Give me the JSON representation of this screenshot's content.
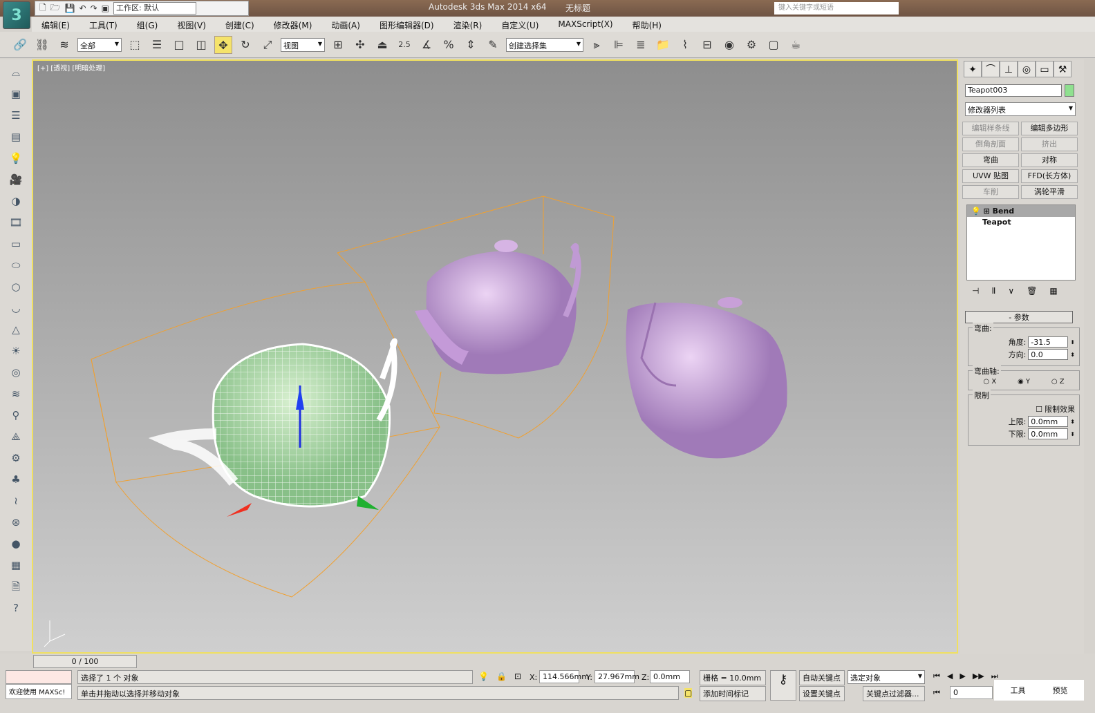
{
  "app": {
    "title": "Autodesk 3ds Max  2014 x64",
    "document": "无标题",
    "workspace": "工作区: 默认",
    "search_placeholder": "键入关键字或短语"
  },
  "menu": [
    "编辑(E)",
    "工具(T)",
    "组(G)",
    "视图(V)",
    "创建(C)",
    "修改器(M)",
    "动画(A)",
    "图形编辑器(D)",
    "渲染(R)",
    "自定义(U)",
    "MAXScript(X)",
    "帮助(H)"
  ],
  "toolbar": {
    "filter": "全部",
    "ref_coord": "视图",
    "snap_angle": "2.5",
    "selection_set": "创建选择集"
  },
  "viewport": {
    "label": "[+] [透视] [明暗处理]",
    "colors": {
      "border": "#f0e060",
      "bbox": "#f0a030",
      "teapot": "#c9a0d8",
      "selected": "#a8d8a0"
    }
  },
  "right_panel": {
    "object_name": "Teapot003",
    "modifier_list": "修改器列表",
    "modifier_buttons": [
      {
        "label": "编辑样条线",
        "enabled": false
      },
      {
        "label": "编辑多边形",
        "enabled": true
      },
      {
        "label": "倒角剖面",
        "enabled": false
      },
      {
        "label": "挤出",
        "enabled": false
      },
      {
        "label": "弯曲",
        "enabled": true
      },
      {
        "label": "对称",
        "enabled": true
      },
      {
        "label": "UVW 贴图",
        "enabled": true
      },
      {
        "label": "FFD(长方体)",
        "enabled": true
      },
      {
        "label": "车削",
        "enabled": false
      },
      {
        "label": "涡轮平滑",
        "enabled": true
      }
    ],
    "stack": [
      "Bend",
      "Teapot"
    ],
    "params": {
      "title": "参数",
      "bend_group": "弯曲:",
      "angle_label": "角度:",
      "angle": "-31.5",
      "direction_label": "方向:",
      "direction": "0.0",
      "axis_group": "弯曲轴:",
      "axes": [
        "X",
        "Y",
        "Z"
      ],
      "axis_selected": "Y",
      "limit_group": "限制",
      "limit_effect": "限制效果",
      "limit_effect_checked": false,
      "upper_label": "上限:",
      "upper": "0.0mm",
      "lower_label": "下限:",
      "lower": "0.0mm"
    }
  },
  "bottom": {
    "time": "0 / 100",
    "maxscript": "欢迎使用 MAXSc!",
    "status1": "选择了 1 个 对象",
    "status2": "单击并拖动以选择并移动对象",
    "x_label": "X:",
    "x": "114.566mm",
    "y_label": "Y:",
    "y": "27.967mm",
    "z_label": "Z:",
    "z": "0.0mm",
    "grid": "栅格 = 10.0mm",
    "add_time_tag": "添加时间标记",
    "auto_key": "自动关键点",
    "set_key": "设置关键点",
    "key_mode": "选定对象",
    "key_filters": "关键点过滤器...",
    "frame": "0",
    "tools": "工具",
    "preview": "预览"
  }
}
